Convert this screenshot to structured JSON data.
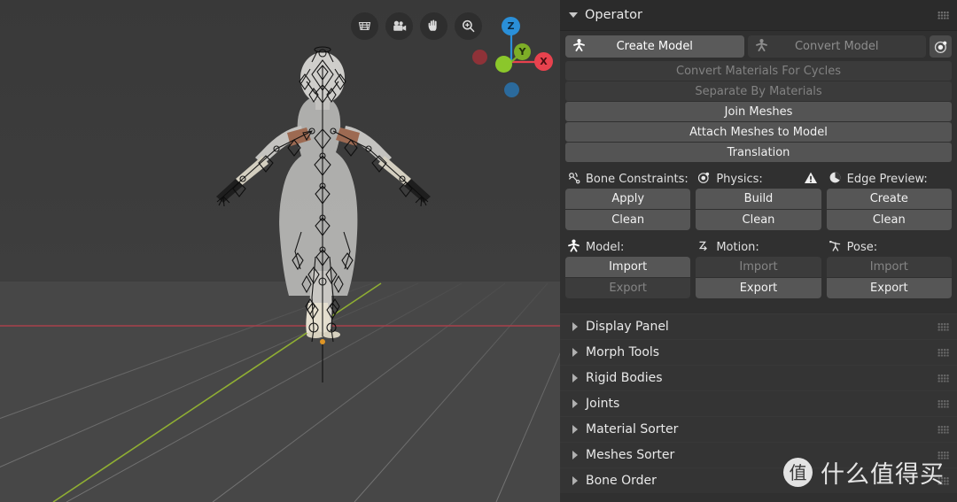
{
  "viewport": {
    "background_color": "#3d3d3d",
    "floor_color": "#474747",
    "grid_line_color": "#5b5b5b",
    "x_axis_color": "#b5434f",
    "y_axis_color": "#94b344",
    "tools": [
      {
        "name": "toggle-orthographic-icon",
        "label": "Toggle Orthographic / Grid"
      },
      {
        "name": "camera-view-icon",
        "label": "Camera View"
      },
      {
        "name": "pan-view-icon",
        "label": "Pan View"
      },
      {
        "name": "zoom-view-icon",
        "label": "Zoom View"
      }
    ],
    "gizmo": {
      "name": "navigation-gizmo",
      "axes": [
        {
          "label": "Z",
          "color": "#2a8fd8"
        },
        {
          "label": "Y",
          "color": "#7dae27"
        },
        {
          "label": "X",
          "color": "#e8424e"
        },
        {
          "label": "",
          "color": "#1f5f8f"
        },
        {
          "label": "",
          "color": "#8e3238"
        },
        {
          "label": "",
          "color": "#8bc72b"
        }
      ]
    },
    "object": {
      "name": "character-armature",
      "description": "3D humanoid character mesh with armature bones overlay"
    }
  },
  "panel": {
    "header": {
      "title": "Operator",
      "expanded": true,
      "grip_icon": "grip-dots-icon"
    },
    "mode_switch": {
      "create": {
        "label": "Create Model",
        "icon": "armature-icon",
        "active": true
      },
      "convert": {
        "label": "Convert Model",
        "icon": "armature-icon",
        "active": false
      },
      "extra_button": {
        "icon": "physics-icon",
        "label": ""
      }
    },
    "operations": [
      {
        "label": "Convert Materials For Cycles",
        "enabled": false
      },
      {
        "label": "Separate By Materials",
        "enabled": false
      },
      {
        "label": "Join Meshes",
        "enabled": true
      },
      {
        "label": "Attach Meshes to Model",
        "enabled": true
      },
      {
        "label": "Translation",
        "enabled": true
      }
    ],
    "tool_groups": [
      {
        "title": "Bone Constraints:",
        "icon": "bone-constraint-icon",
        "warning": false,
        "buttons": [
          {
            "label": "Apply",
            "enabled": true
          },
          {
            "label": "Clean",
            "enabled": true
          }
        ]
      },
      {
        "title": "Physics:",
        "icon": "physics-icon",
        "warning": true,
        "warning_icon": "warning-triangle-icon",
        "buttons": [
          {
            "label": "Build",
            "enabled": true
          },
          {
            "label": "Clean",
            "enabled": true
          }
        ]
      },
      {
        "title": "Edge Preview:",
        "icon": "edge-preview-icon",
        "warning": false,
        "buttons": [
          {
            "label": "Create",
            "enabled": true
          },
          {
            "label": "Clean",
            "enabled": true
          }
        ]
      }
    ],
    "io_groups": [
      {
        "title": "Model:",
        "icon": "armature-icon",
        "buttons": [
          {
            "label": "Import",
            "enabled": true
          },
          {
            "label": "Export",
            "enabled": false
          }
        ]
      },
      {
        "title": "Motion:",
        "icon": "motion-curve-icon",
        "buttons": [
          {
            "label": "Import",
            "enabled": false
          },
          {
            "label": "Export",
            "enabled": true
          }
        ]
      },
      {
        "title": "Pose:",
        "icon": "pose-icon",
        "buttons": [
          {
            "label": "Import",
            "enabled": false
          },
          {
            "label": "Export",
            "enabled": true
          }
        ]
      }
    ],
    "collapsed_panels": [
      {
        "label": "Display Panel"
      },
      {
        "label": "Morph Tools"
      },
      {
        "label": "Rigid Bodies"
      },
      {
        "label": "Joints"
      },
      {
        "label": "Material Sorter"
      },
      {
        "label": "Meshes Sorter"
      },
      {
        "label": "Bone Order"
      }
    ]
  },
  "watermark": {
    "logo_glyph": "值",
    "text": "什么值得买"
  }
}
